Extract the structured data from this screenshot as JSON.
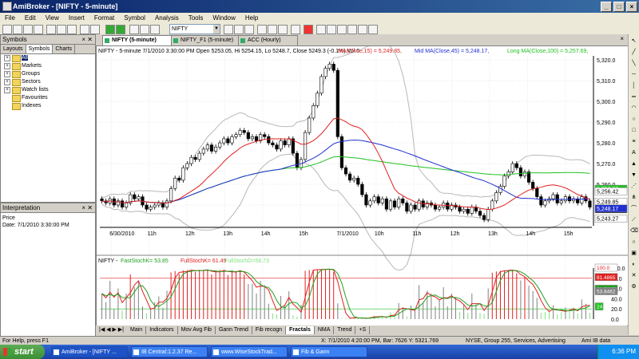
{
  "window": {
    "title": "AmiBroker - [NIFTY - 5-minute]"
  },
  "menu": [
    "File",
    "Edit",
    "View",
    "Insert",
    "Format",
    "Symbol",
    "Analysis",
    "Tools",
    "Window",
    "Help"
  ],
  "toolbar": {
    "symbol": "NIFTY"
  },
  "symbols_panel": {
    "title": "Symbols",
    "tabs": [
      "Layouts",
      "Symbols",
      "Charts"
    ],
    "active_tab": "Symbols",
    "tree": [
      {
        "label": "All",
        "selected": true
      },
      {
        "label": "Markets"
      },
      {
        "label": "Groups"
      },
      {
        "label": "Sectors"
      },
      {
        "label": "Watch lists"
      },
      {
        "label": "Favourites"
      },
      {
        "label": "Indexes"
      }
    ]
  },
  "interpretation": {
    "title": "Interpretation",
    "line1": "Price",
    "line2": "Date: 7/1/2010 3:30:00 PM"
  },
  "chart_tabs": [
    "NIFTY (5-minute)",
    "NIFTY_F1 (5-minute)",
    "ACC (Hourly)"
  ],
  "chart_header": {
    "main": "NIFTY - 5-minute 7/1/2010 3:30:00 PM Open 5253.05, Hi 5254.15, Lo 5248.7, Close 5249.3 (-0.1%) Vol 0",
    "ma1": "MA(Close,15) = 5,249.85,",
    "ma2": "Mid MA(Close,45) = 5,248.17,",
    "ma3": "Long MA(Close,100) = 5,257.69,"
  },
  "colors": {
    "ma15": "#e02020",
    "ma45": "#2030d0",
    "ma100": "#20c020",
    "bb": "#b8b8b8",
    "up": "#ffffff",
    "down": "#000000"
  },
  "chart_data": [
    {
      "type": "candlestick",
      "title": "NIFTY - 5-minute",
      "ylim": [
        5240,
        5322
      ],
      "yticks": [
        5250,
        5260,
        5270,
        5280,
        5290,
        5300,
        5310,
        5320
      ],
      "ytick_labels": [
        "5,250.0",
        "5,260.0",
        "5,270.0",
        "5,280.0",
        "5,290.0",
        "5,300.0",
        "5,310.0",
        "5,320.0"
      ],
      "xtick_labels": [
        "6/30/2010",
        "11h",
        "12h",
        "13h",
        "14h",
        "15h",
        "7/1/2010",
        "10h",
        "11h",
        "12h",
        "13h",
        "14h",
        "15h"
      ],
      "close": [
        5252,
        5251,
        5253,
        5250,
        5252,
        5249,
        5251,
        5255,
        5253,
        5254,
        5250,
        5248,
        5249,
        5250,
        5251,
        5249,
        5252,
        5258,
        5263,
        5262,
        5268,
        5270,
        5273,
        5272,
        5275,
        5277,
        5279,
        5276,
        5278,
        5280,
        5282,
        5280,
        5283,
        5284,
        5286,
        5285,
        5282,
        5283,
        5281,
        5284,
        5283,
        5280,
        5279,
        5277,
        5281,
        5279,
        5282,
        5275,
        5268,
        5272,
        5285,
        5292,
        5298,
        5304,
        5312,
        5316,
        5318,
        5315,
        5283,
        5268,
        5265,
        5262,
        5263,
        5260,
        5255,
        5250,
        5252,
        5254,
        5251,
        5253,
        5248,
        5252,
        5249,
        5253,
        5251,
        5247,
        5250,
        5248,
        5252,
        5249,
        5251,
        5250,
        5248,
        5249,
        5251,
        5248,
        5250,
        5249,
        5247,
        5248,
        5246,
        5249,
        5247,
        5245,
        5243,
        5248,
        5252,
        5256,
        5259,
        5264,
        5266,
        5270,
        5268,
        5264,
        5266,
        5261,
        5258,
        5254,
        5250,
        5252,
        5253,
        5255,
        5251,
        5252,
        5254,
        5252,
        5253,
        5251,
        5254,
        5252,
        5249
      ],
      "price_labels": [
        {
          "text": "5,257.69",
          "color": "#20c020"
        },
        {
          "text": "5,256.42",
          "color": "#ffffff"
        },
        {
          "text": "5,249.85",
          "color": "#ffffff"
        },
        {
          "text": "5,249.30",
          "color": "#ffffff"
        },
        {
          "text": "5,248.17",
          "color": "#2030d0"
        },
        {
          "text": "5,243.27",
          "color": "#ffffff"
        }
      ]
    },
    {
      "type": "stochastic",
      "title": "NIFTY -",
      "fast_label": "FastStochK= 53.85",
      "full_label": "FullStochK= 61.49",
      "extra_label": "FullStochD=58.73",
      "ylim": [
        0,
        100
      ],
      "ytick_labels": [
        "0.0",
        "20.0",
        "40.0",
        "60.0",
        "80.0",
        "100.0"
      ],
      "right_labels": [
        {
          "text": "100.0",
          "color": "#e02020"
        },
        {
          "text": "81.4865",
          "color": "#e02020"
        },
        {
          "text": "58.7327",
          "color": "#20a020"
        },
        {
          "text": "53.8462",
          "color": "#808080"
        },
        {
          "text": "24",
          "color": "#20c020"
        }
      ],
      "upper_band": 80,
      "lower_band": 20
    }
  ],
  "bottom_tabs": [
    "Main",
    "Indicators",
    "Mov Avg Fib",
    "Gann Trend",
    "Fib recogn",
    "Fractals",
    "NMA",
    "Trend",
    "+S"
  ],
  "active_bottom_tab": "Fractals",
  "status": {
    "left": "For Help, press F1",
    "coords": "X: 7/1/2010 4:20:00 PM, Bar: 7626   Y: 5321.769",
    "info": "NYSE, Group 255, Services, Advertising",
    "db": "Ami IB data"
  },
  "taskbar": {
    "start": "start",
    "items": [
      "AmiBroker - [NIFTY ...",
      "IB Central:1.2.37 Re...",
      "www.WiseStockTrad...",
      "Fib & Gann"
    ],
    "clock": "6:36 PM"
  }
}
